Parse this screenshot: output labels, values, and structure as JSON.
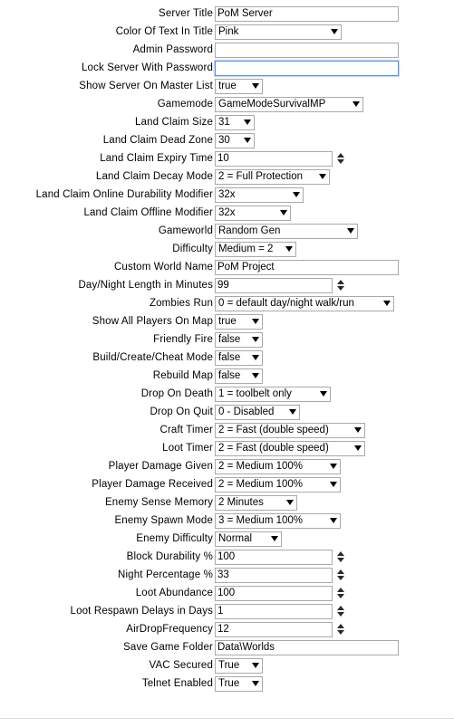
{
  "form": {
    "rows": [
      {
        "label": "Server Title",
        "type": "text",
        "value": "PoM Server",
        "width": "wide",
        "focused": false
      },
      {
        "label": "Color Of Text In Title",
        "type": "select",
        "value": "Pink",
        "width": "w-pink"
      },
      {
        "label": "Admin Password",
        "type": "text",
        "value": "",
        "width": "wide",
        "focused": false
      },
      {
        "label": "Lock Server With Password",
        "type": "text",
        "value": "",
        "width": "wide",
        "focused": true
      },
      {
        "label": "Show Server On Master List",
        "type": "select",
        "value": "true",
        "width": "w-bool"
      },
      {
        "label": "Gamemode",
        "type": "select",
        "value": "GameModeSurvivalMP",
        "width": "w-gamemode"
      },
      {
        "label": "Land Claim Size",
        "type": "select",
        "value": "31",
        "width": "w-small"
      },
      {
        "label": "Land Claim Dead Zone",
        "type": "select",
        "value": "30",
        "width": "w-small"
      },
      {
        "label": "Land Claim Expiry Time",
        "type": "number",
        "value": "10",
        "width": "num"
      },
      {
        "label": "Land Claim Decay Mode",
        "type": "select",
        "value": "2 = Full Protection",
        "width": "w-decay"
      },
      {
        "label": "Land Claim Online Durability Modifier",
        "type": "select",
        "value": "32x",
        "width": "w-online"
      },
      {
        "label": "Land Claim Offline Modifier",
        "type": "select",
        "value": "32x",
        "width": "w-offline"
      },
      {
        "label": "Gameworld",
        "type": "select",
        "value": "Random Gen",
        "width": "w-gameworld"
      },
      {
        "label": "Difficulty",
        "type": "select",
        "value": "Medium = 2",
        "width": "w-diff"
      },
      {
        "label": "Custom World Name",
        "type": "text",
        "value": "PoM Project",
        "width": "wide",
        "focused": false
      },
      {
        "label": "Day/Night Length in Minutes",
        "type": "number",
        "value": "99",
        "width": "num"
      },
      {
        "label": "Zombies Run",
        "type": "select",
        "value": "0 = default day/night walk/run",
        "width": "w-zombies"
      },
      {
        "label": "Show All Players On Map",
        "type": "select",
        "value": "true",
        "width": "w-bool"
      },
      {
        "label": "Friendly Fire",
        "type": "select",
        "value": "false",
        "width": "w-bool"
      },
      {
        "label": "Build/Create/Cheat Mode",
        "type": "select",
        "value": "false",
        "width": "w-bool"
      },
      {
        "label": "Rebuild Map",
        "type": "select",
        "value": "false",
        "width": "w-bool"
      },
      {
        "label": "Drop On Death",
        "type": "select",
        "value": "1 = toolbelt only",
        "width": "w-dropdeath"
      },
      {
        "label": "Drop On Quit",
        "type": "select",
        "value": "0 - Disabled",
        "width": "w-dropquit"
      },
      {
        "label": "Craft Timer",
        "type": "select",
        "value": "2 = Fast (double speed)",
        "width": "w-timer"
      },
      {
        "label": "Loot Timer",
        "type": "select",
        "value": "2 = Fast (double speed)",
        "width": "w-timer"
      },
      {
        "label": "Player Damage Given",
        "type": "select",
        "value": "2 = Medium 100%",
        "width": "w-damage"
      },
      {
        "label": "Player Damage Received",
        "type": "select",
        "value": "2 = Medium 100%",
        "width": "w-damage"
      },
      {
        "label": "Enemy Sense Memory",
        "type": "select",
        "value": "2 Minutes",
        "width": "w-sense"
      },
      {
        "label": "Enemy Spawn Mode",
        "type": "select",
        "value": "3 = Medium 100%",
        "width": "w-spawn"
      },
      {
        "label": "Enemy Difficulty",
        "type": "select",
        "value": "Normal",
        "width": "w-enemydiff"
      },
      {
        "label": "Block Durability %",
        "type": "number",
        "value": "100",
        "width": "num"
      },
      {
        "label": "Night Percentage %",
        "type": "number",
        "value": "33",
        "width": "num"
      },
      {
        "label": "Loot Abundance",
        "type": "number",
        "value": "100",
        "width": "num"
      },
      {
        "label": "Loot Respawn Delays in Days",
        "type": "number",
        "value": "1",
        "width": "num"
      },
      {
        "label": "AirDropFrequency",
        "type": "number",
        "value": "12",
        "width": "num"
      },
      {
        "label": "Save Game Folder",
        "type": "text",
        "value": "Data\\Worlds",
        "width": "wide",
        "focused": false
      },
      {
        "label": "VAC Secured",
        "type": "select",
        "value": "True",
        "width": "w-bool"
      },
      {
        "label": "Telnet Enabled",
        "type": "select",
        "value": "True",
        "width": "w-bool"
      }
    ]
  },
  "colors": {
    "focus_border": "#5a8fd6",
    "field_border": "#a9a9a9",
    "text": "#000000",
    "background": "#ffffff",
    "divider": "#dcdcdc"
  }
}
